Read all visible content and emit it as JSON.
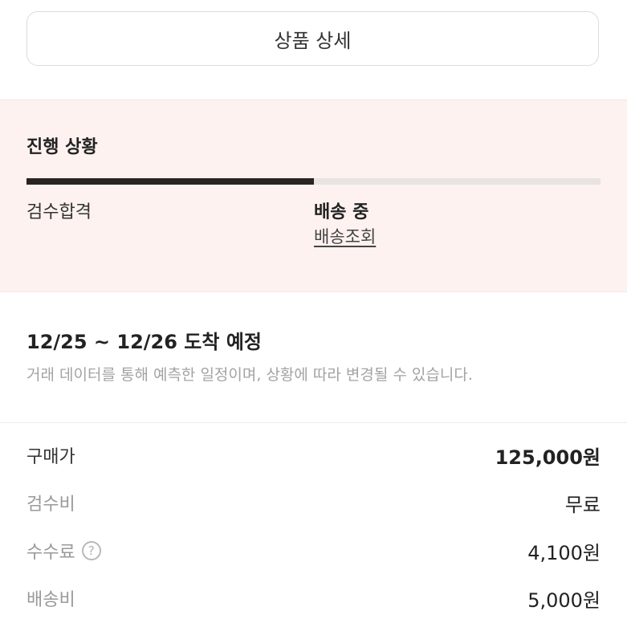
{
  "header": {
    "detail_button": "상품 상세"
  },
  "progress": {
    "title": "진행 상황",
    "fill_percent": 50,
    "step_done": "검수합격",
    "step_current": "배송 중",
    "tracking_link": "배송조회",
    "fill_color": "#2b2322",
    "background_color": "#fdf2ef"
  },
  "arrival": {
    "title": "12/25 ~ 12/26 도착 예정",
    "note": "거래 데이터를 통해 예측한 일정이며, 상황에 따라 변경될 수 있습니다."
  },
  "prices": {
    "purchase_label": "구매가",
    "purchase_value": "125,000원",
    "inspection_label": "검수비",
    "inspection_value": "무료",
    "fee_label": "수수료",
    "fee_help_icon": "?",
    "fee_value": "4,100원",
    "shipping_label": "배송비",
    "shipping_value": "5,000원"
  }
}
